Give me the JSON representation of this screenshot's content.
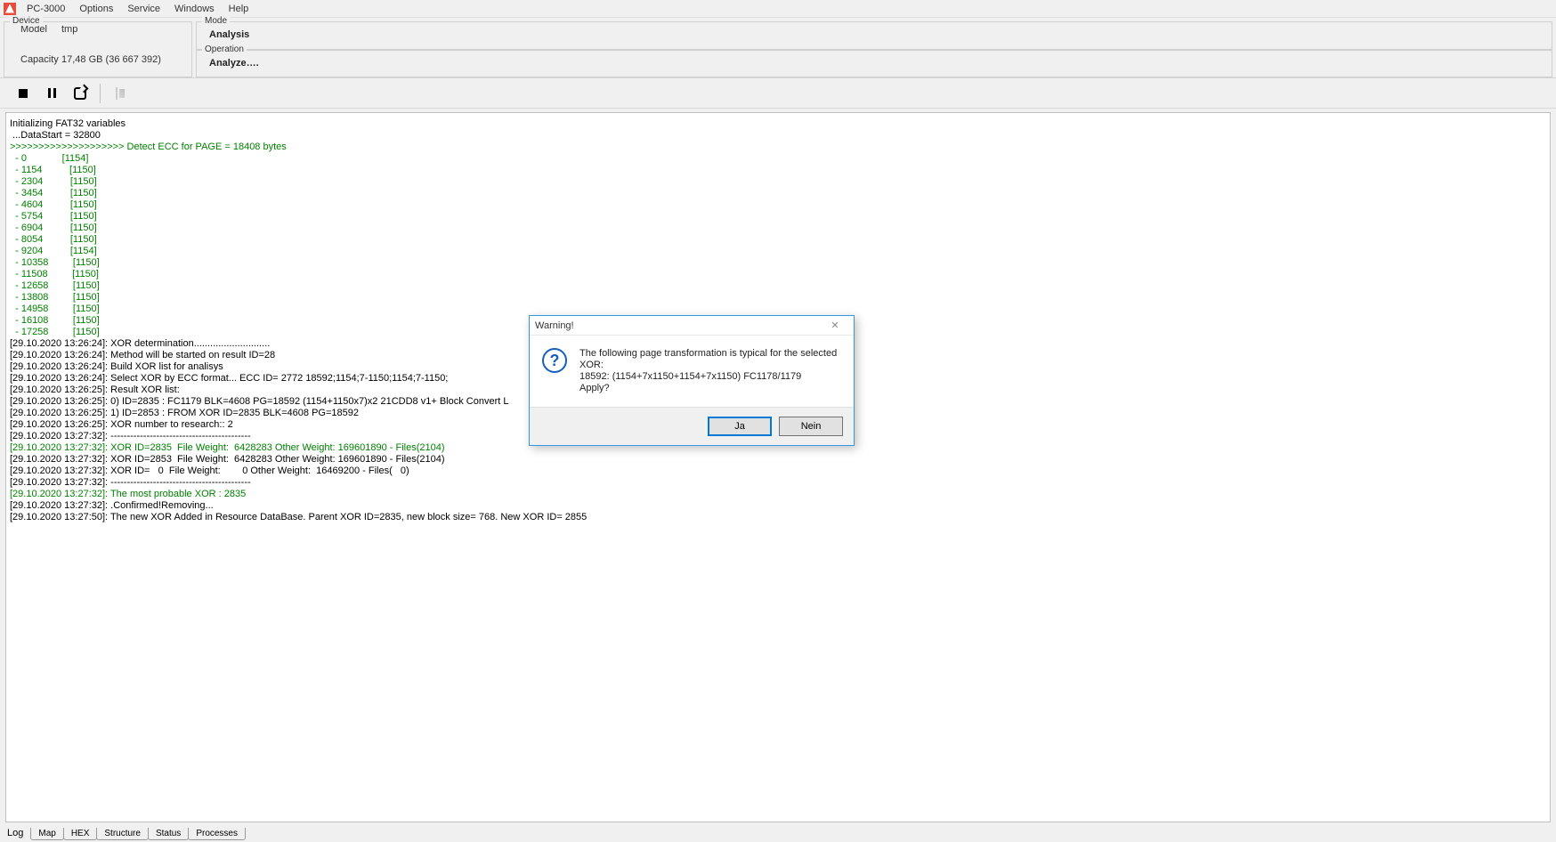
{
  "app_title": "PC-3000",
  "menu": {
    "options": "Options",
    "service": "Service",
    "windows": "Windows",
    "help": "Help"
  },
  "device": {
    "legend": "Device",
    "model_lbl": "Model",
    "model": "tmp",
    "cap_lbl": "Capacity",
    "cap": "17,48 GB (36 667 392)"
  },
  "mode": {
    "legend": "Mode",
    "value": "Analysis"
  },
  "op": {
    "legend": "Operation",
    "value": "Analyze…."
  },
  "tabs": {
    "log": "Log",
    "map": "Map",
    "hex": "HEX",
    "structure": "Structure",
    "status": "Status",
    "processes": "Processes"
  },
  "dialog": {
    "title": "Warning!",
    "msg": "The following page transformation is typical for the selected XOR:\n18592: (1154+7x1150+1154+7x1150) FC1178/1179\nApply?",
    "yes": "Ja",
    "no": "Nein"
  },
  "log_lines": [
    {
      "c": "b",
      "t": "Initializing FAT32 variables"
    },
    {
      "c": "b",
      "t": " ...DataStart = 32800"
    },
    {
      "c": "g",
      "t": ">>>>>>>>>>>>>>>>>>>> Detect ECC for PAGE = 18408 bytes"
    },
    {
      "c": "g",
      "t": "  - 0             [1154]"
    },
    {
      "c": "g",
      "t": "  - 1154          [1150]"
    },
    {
      "c": "g",
      "t": "  - 2304          [1150]"
    },
    {
      "c": "g",
      "t": "  - 3454          [1150]"
    },
    {
      "c": "g",
      "t": "  - 4604          [1150]"
    },
    {
      "c": "g",
      "t": "  - 5754          [1150]"
    },
    {
      "c": "g",
      "t": "  - 6904          [1150]"
    },
    {
      "c": "g",
      "t": "  - 8054          [1150]"
    },
    {
      "c": "g",
      "t": "  - 9204          [1154]"
    },
    {
      "c": "g",
      "t": "  - 10358         [1150]"
    },
    {
      "c": "g",
      "t": "  - 11508         [1150]"
    },
    {
      "c": "g",
      "t": "  - 12658         [1150]"
    },
    {
      "c": "g",
      "t": "  - 13808         [1150]"
    },
    {
      "c": "g",
      "t": "  - 14958         [1150]"
    },
    {
      "c": "g",
      "t": "  - 16108         [1150]"
    },
    {
      "c": "g",
      "t": "  - 17258         [1150]"
    },
    {
      "c": "b",
      "t": "[29.10.2020 13:26:24]: XOR determination............................"
    },
    {
      "c": "b",
      "t": "[29.10.2020 13:26:24]: Method will be started on result ID=28"
    },
    {
      "c": "b",
      "t": "[29.10.2020 13:26:24]: Build XOR list for analisys"
    },
    {
      "c": "b",
      "t": "[29.10.2020 13:26:24]: Select XOR by ECC format... ECC ID= 2772 18592;1154;7-1150;1154;7-1150;"
    },
    {
      "c": "b",
      "t": "[29.10.2020 13:26:25]: Result XOR list:"
    },
    {
      "c": "b",
      "t": "[29.10.2020 13:26:25]: 0) ID=2835 : FC1179 BLK=4608 PG=18592 (1154+1150x7)x2 21CDD8 v1+ Block Convert L"
    },
    {
      "c": "b",
      "t": "[29.10.2020 13:26:25]: 1) ID=2853 : FROM XOR ID=2835 BLK=4608 PG=18592"
    },
    {
      "c": "b",
      "t": "[29.10.2020 13:26:25]: XOR number to research:: 2"
    },
    {
      "c": "b",
      "t": "[29.10.2020 13:27:32]: -------------------------------------------"
    },
    {
      "c": "g",
      "t": "[29.10.2020 13:27:32]: XOR ID=2835  File Weight:  6428283 Other Weight: 169601890 - Files(2104)"
    },
    {
      "c": "b",
      "t": "[29.10.2020 13:27:32]: XOR ID=2853  File Weight:  6428283 Other Weight: 169601890 - Files(2104)"
    },
    {
      "c": "b",
      "t": "[29.10.2020 13:27:32]: XOR ID=   0  File Weight:        0 Other Weight:  16469200 - Files(   0)"
    },
    {
      "c": "b",
      "t": "[29.10.2020 13:27:32]: -------------------------------------------"
    },
    {
      "c": "g",
      "t": "[29.10.2020 13:27:32]: The most probable XOR : 2835"
    },
    {
      "c": "b",
      "t": "[29.10.2020 13:27:32]: .Confirmed!Removing..."
    },
    {
      "c": "b",
      "t": "[29.10.2020 13:27:50]: The new XOR Added in Resource DataBase. Parent XOR ID=2835, new block size= 768. New XOR ID= 2855"
    }
  ]
}
